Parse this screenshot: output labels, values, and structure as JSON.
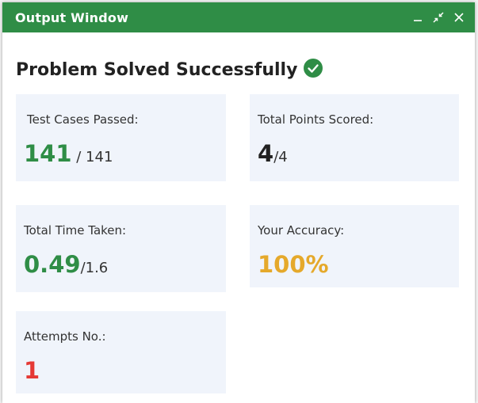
{
  "window": {
    "title": "Output Window",
    "controls": [
      "minimize-icon",
      "collapse-arrows-icon",
      "close-icon"
    ]
  },
  "heading": {
    "text": "Problem Solved Successfully",
    "icon": "check-circle-icon",
    "icon_color": "#2f8d46"
  },
  "colors": {
    "brand_green": "#2f8d46",
    "accent_yellow": "#e5a92b",
    "error_red": "#e53935",
    "card_bg": "#f0f4fb"
  },
  "cards": {
    "test_cases": {
      "label": "Test Cases Passed:",
      "value": "141",
      "total": " / 141"
    },
    "points": {
      "label": "Total Points Scored:",
      "value": "4",
      "total": "/4"
    },
    "time": {
      "label": "Total Time Taken:",
      "value": "0.49",
      "total": "/1.6"
    },
    "accuracy": {
      "label": "Your Accuracy:",
      "value": "100%"
    },
    "attempts": {
      "label": "Attempts No.:",
      "value": "1"
    }
  }
}
